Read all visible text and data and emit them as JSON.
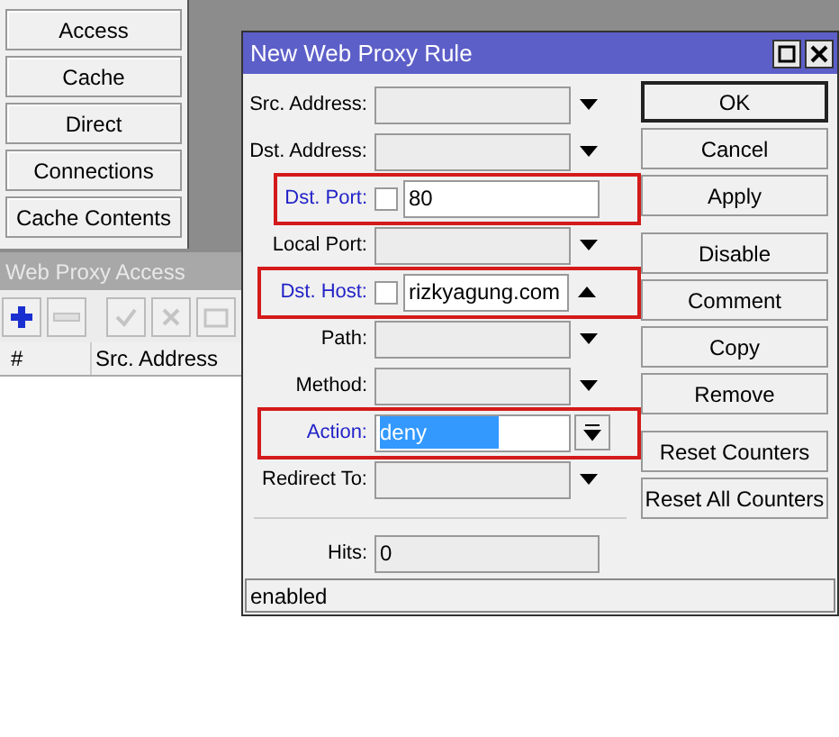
{
  "menu_buttons": [
    "Access",
    "Cache",
    "Direct",
    "Connections",
    "Cache Contents"
  ],
  "access_window": {
    "title": "Web Proxy Access",
    "toolbar": [
      {
        "kind": "add",
        "disabled": false
      },
      {
        "kind": "remove",
        "disabled": true
      },
      {
        "kind": "enable",
        "disabled": true
      },
      {
        "kind": "disable",
        "disabled": true
      },
      {
        "kind": "comment",
        "disabled": true
      }
    ],
    "columns": [
      "#",
      "Src. Address"
    ]
  },
  "dialog": {
    "title": "New Web Proxy Rule",
    "fields": [
      {
        "kind": "dropdown",
        "label": "Src. Address:",
        "highlighted": false
      },
      {
        "kind": "dropdown",
        "label": "Dst. Address:",
        "highlighted": false
      },
      {
        "kind": "text",
        "label": "Dst. Port:",
        "highlighted": true,
        "checkbox": {
          "checked": false
        },
        "value": "80"
      },
      {
        "kind": "dropdown",
        "label": "Local Port:",
        "highlighted": false
      },
      {
        "kind": "list",
        "label": "Dst. Host:",
        "highlighted": true,
        "checkbox": {
          "checked": false
        },
        "value": "rizkyagung.com"
      },
      {
        "kind": "dropdown",
        "label": "Path:",
        "highlighted": false
      },
      {
        "kind": "dropdown",
        "label": "Method:",
        "highlighted": false
      },
      {
        "kind": "combo",
        "label": "Action:",
        "highlighted": true,
        "value": "deny",
        "value_selected": true
      },
      {
        "kind": "dropdown",
        "label": "Redirect To:",
        "highlighted": false
      }
    ],
    "hits": {
      "label": "Hits:",
      "value": "0"
    },
    "button_groups": [
      [
        {
          "label": "OK",
          "default": true
        },
        {
          "label": "Cancel",
          "default": false
        },
        {
          "label": "Apply",
          "default": false
        }
      ],
      [
        {
          "label": "Disable",
          "default": false
        },
        {
          "label": "Comment",
          "default": false
        },
        {
          "label": "Copy",
          "default": false
        },
        {
          "label": "Remove",
          "default": false
        }
      ],
      [
        {
          "label": "Reset Counters",
          "default": false
        },
        {
          "label": "Reset All Counters",
          "default": false
        }
      ]
    ],
    "status": "enabled"
  }
}
